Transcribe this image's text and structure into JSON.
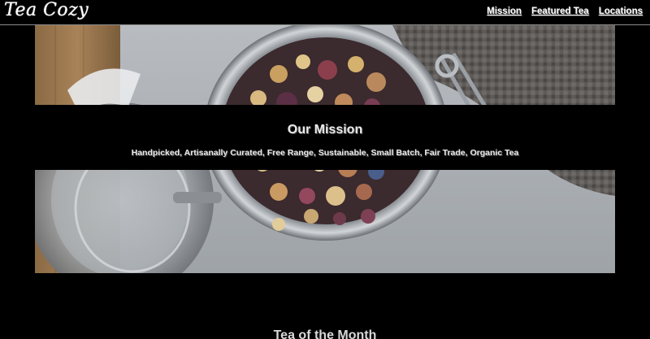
{
  "header": {
    "logo": "Tea Cozy",
    "nav": [
      {
        "label": "Mission"
      },
      {
        "label": "Featured Tea"
      },
      {
        "label": "Locations"
      }
    ]
  },
  "mission": {
    "title": "Our Mission",
    "subtitle": "Handpicked, Artisanally Curated, Free Range, Sustainable, Small Batch, Fair Trade, Organic Tea"
  },
  "tea_of_month": {
    "title": "Tea of the Month"
  },
  "colors": {
    "background": "#000000",
    "text": "#ffffff"
  },
  "hero_image": "tea-jar-photo"
}
